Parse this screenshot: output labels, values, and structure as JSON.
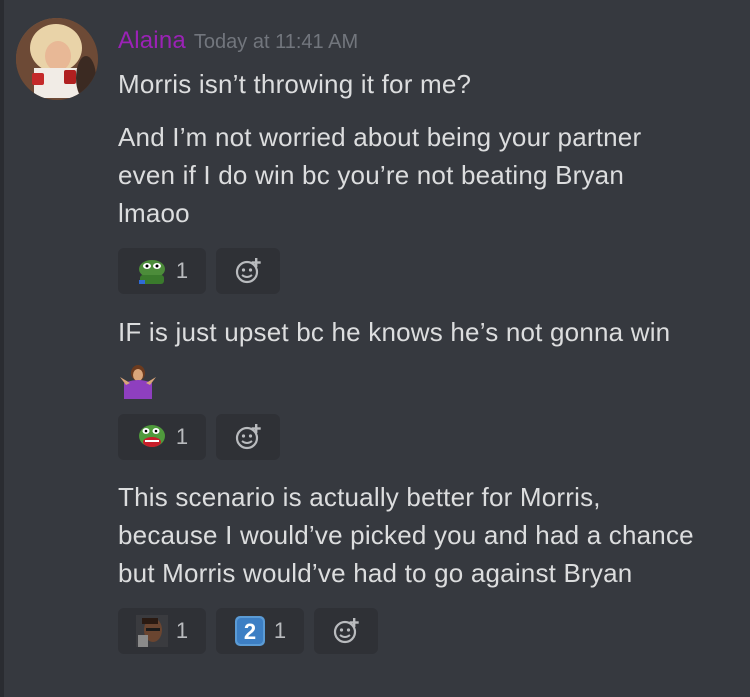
{
  "message": {
    "username": "Alaina",
    "timestamp": "Today at 11:41 AM",
    "lines": [
      "Morris isn’t throwing it for me?",
      "And I’m not worried about being your partner\neven if I do win bc you’re not beating Bryan\nlmaoo",
      "IF is just upset bc he knows he’s not gonna win",
      "This scenario is actually better for Morris,\nbecause I would’ve picked you and had a chance\nbut Morris would’ve had to go against Bryan"
    ],
    "reactions_1": [
      {
        "emoji": "pepe-hug-emoji",
        "count": "1"
      }
    ],
    "reactions_2": [
      {
        "emoji": "pepe-scream-emoji",
        "count": "1"
      }
    ],
    "reactions_3": [
      {
        "emoji": "man-face-emoji",
        "count": "1"
      },
      {
        "emoji": "keycap-2-emoji",
        "keycap": "2",
        "count": "1"
      }
    ]
  },
  "colors": {
    "background": "#36393f",
    "username": "#9b22b6",
    "text": "#dcddde",
    "muted": "#72767d",
    "reaction_bg": "#2f3136"
  }
}
